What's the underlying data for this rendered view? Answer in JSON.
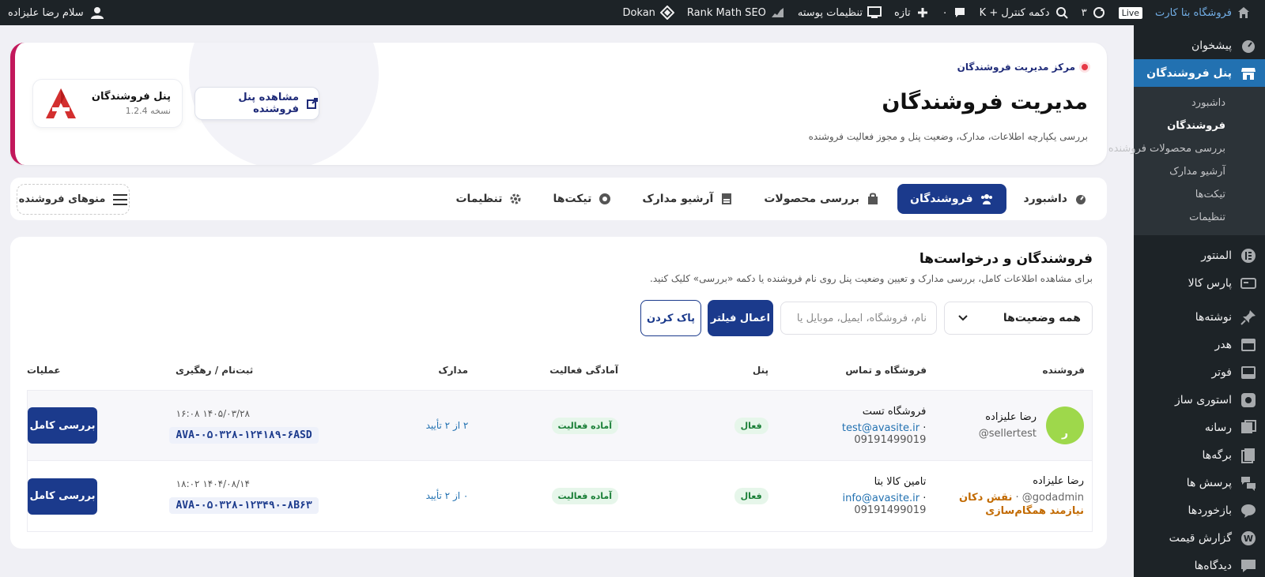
{
  "admin_bar": {
    "site_name": "فروشگاه بتا کارت",
    "live": "Live",
    "updates_count": "۳",
    "shortcut": "دکمه کنترل + K",
    "comments_count": "۰",
    "new_label": "تازه",
    "post_settings": "تنظیمات پوسته",
    "rank_math": "Rank Math SEO",
    "dokan": "Dokan",
    "greeting": "سلام رضا علیزاده"
  },
  "sidebar": {
    "dashboard": "پیشخوان",
    "vendors_panel": "پنل فروشندگان",
    "submenu": [
      "داشبورد",
      "فروشندگان",
      "بررسی محصولات فروشنده",
      "آرشیو مدارک",
      "تیکت‌ها",
      "تنظیمات"
    ],
    "items": [
      "المنتور",
      "پارس کالا",
      "نوشته‌ها",
      "هدر",
      "فوتر",
      "استوری ساز",
      "رسانه",
      "برگه‌ها",
      "پرسش ها",
      "بازخوردها",
      "گزارش قیمت",
      "دیدگاه‌ها"
    ]
  },
  "hero": {
    "crumb": "مرکز مدیریت فروشندگان",
    "title": "مدیریت فروشندگان",
    "description": "بررسی یکپارچه اطلاعات، مدارک، وضعیت پنل و مجوز فعالیت فروشنده",
    "view_panel_button": "مشاهده پنل فروشنده",
    "plugin_name": "پنل فروشندگان",
    "plugin_version": "نسخه 1.2.4"
  },
  "tabs": {
    "items": [
      "داشبورد",
      "فروشندگان",
      "بررسی محصولات",
      "آرشیو مدارک",
      "تیکت‌ها",
      "تنظیمات"
    ],
    "vendor_menus": "منوهای فروشنده"
  },
  "panel": {
    "title": "فروشندگان و درخواست‌ها",
    "description": "برای مشاهده اطلاعات کامل، بررسی مدارک و تعیین وضعیت پنل روی نام فروشنده یا دکمه «بررسی» کلیک کنید.",
    "status_select": "همه وضعیت‌ها",
    "search_placeholder": "نام، فروشگاه، ایمیل، موبایل یا",
    "apply_button": "اعمال فیلتر",
    "clear_button": "پاک کردن"
  },
  "table": {
    "headers": [
      "فروشنده",
      "فروشگاه و تماس",
      "پنل",
      "آمادگی فعالیت",
      "مدارک",
      "ثبت‌نام / رهگیری",
      "عملیات"
    ],
    "rows": [
      {
        "avatar_letter": "ر",
        "name": "رضا علیزاده",
        "username": "sellertest@",
        "store": "فروشگاه تست",
        "email": "test@avasite.ir",
        "phone": "09191499019",
        "panel_status": "فعال",
        "readiness": "آماده فعالیت",
        "docs": "۲ از ۲ تأیید",
        "date": "۱۴۰۵/۰۳/۲۸ ۱۶:۰۸",
        "tracking": "AVA-۰۵۰۳۲۸-۱۲۴۱۸۹-۶ASD",
        "action": "بررسی کامل"
      },
      {
        "name": "رضا علیزاده",
        "username": "godadmin@",
        "role": "نقش دکان",
        "sync_note": "نیازمند همگام‌سازی",
        "store": "تامین کالا بتا",
        "email": "info@avasite.ir",
        "phone": "09191499019",
        "panel_status": "فعال",
        "readiness": "آماده فعالیت",
        "docs": "۰ از ۲ تأیید",
        "date": "۱۴۰۴/۰۸/۱۴ ۱۸:۰۲",
        "tracking": "AVA-۰۵۰۳۲۸-۱۲۳۴۹۰-۸B۶۳",
        "action": "بررسی کامل"
      }
    ]
  }
}
